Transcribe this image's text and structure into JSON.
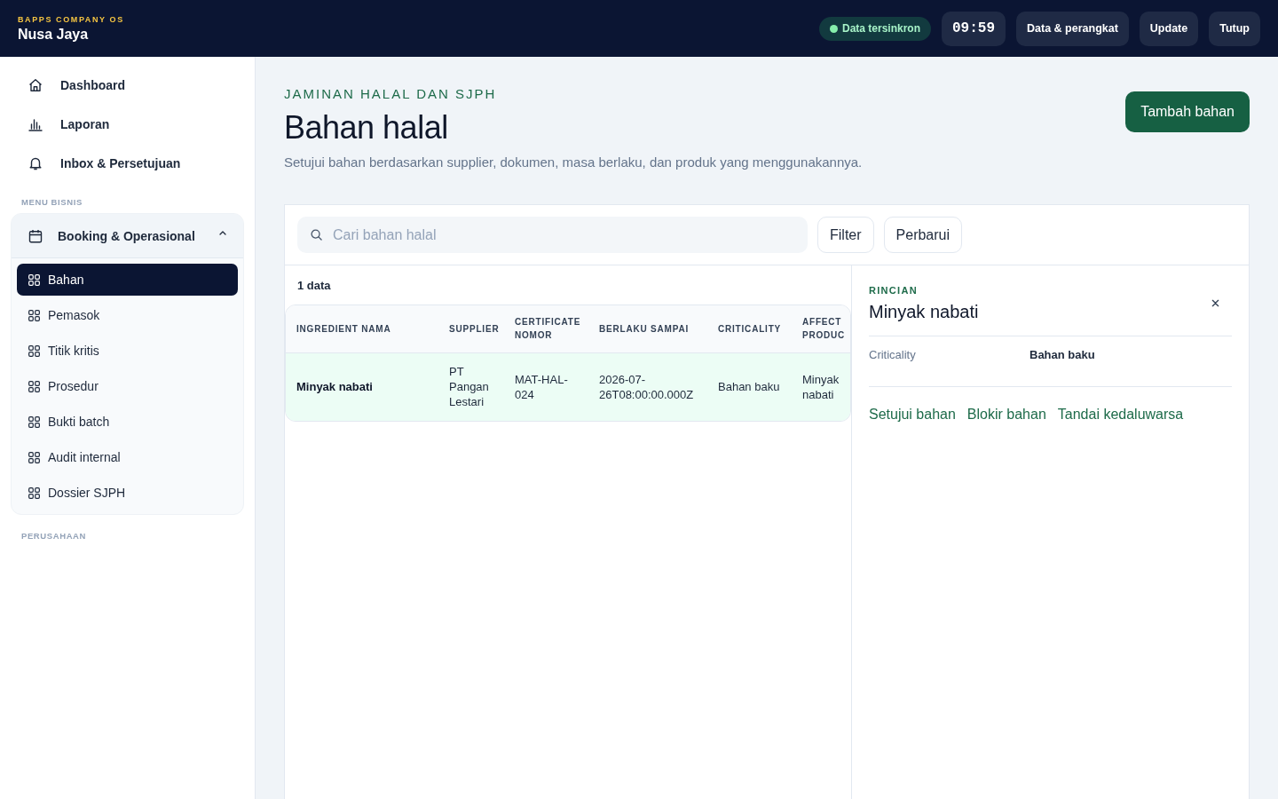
{
  "topbar": {
    "eyebrow": "BAPPS COMPANY OS",
    "title": "Nusa Jaya",
    "sync_status": "Data tersinkron",
    "clock": "09:59",
    "buttons": [
      "Data & perangkat",
      "Update",
      "Tutup"
    ]
  },
  "sidebar": {
    "items": [
      {
        "label": "Dashboard",
        "selected": false
      },
      {
        "label": "Laporan",
        "selected": false
      },
      {
        "label": "Inbox & Persetujuan",
        "selected": false
      }
    ],
    "sections": [
      {
        "title": "MENU BISNIS",
        "groups": [
          {
            "label": "Booking & Operasional",
            "expanded": true,
            "children": [
              {
                "label": "Bahan",
                "selected": true
              },
              {
                "label": "Pemasok",
                "selected": false
              },
              {
                "label": "Titik kritis",
                "selected": false
              },
              {
                "label": "Prosedur",
                "selected": false
              },
              {
                "label": "Bukti batch",
                "selected": false
              },
              {
                "label": "Audit internal",
                "selected": false
              },
              {
                "label": "Dossier SJPH",
                "selected": false
              }
            ]
          }
        ]
      },
      {
        "title": "PERUSAHAAN"
      }
    ]
  },
  "header": {
    "eyebrow": "JAMINAN HALAL DAN SJPH",
    "title": "Bahan halal",
    "subtitle": "Setujui bahan berdasarkan supplier, dokumen, masa berlaku, dan produk yang menggunakannya.",
    "primary_button": "Tambah bahan"
  },
  "toolbar": {
    "search": {
      "placeholder": "Cari bahan halal"
    },
    "buttons": [
      "Filter",
      "Perbarui"
    ]
  },
  "table": {
    "count": "1 data",
    "columns": [
      "INGREDIENT NAMA",
      "SUPPLIER",
      "CERTIFICATE NOMOR",
      "BERLAKU SAMPAI",
      "CRITICALITY",
      "AFFECT PRODUC"
    ],
    "rows": [
      {
        "selected": true,
        "cells": [
          "Minyak nabati",
          "PT Pangan Lestari",
          "MAT-HAL-024",
          "2026-07-26T08:00:00.000Z",
          "Bahan baku",
          "Minyak nabati"
        ]
      }
    ]
  },
  "detail": {
    "eyebrow": "RINCIAN",
    "title": "Minyak nabati",
    "fields": [
      {
        "label": "Criticality",
        "value": "Bahan baku"
      }
    ],
    "actions": [
      "Setujui bahan",
      "Blokir bahan",
      "Tandai kedaluwarsa"
    ]
  }
}
